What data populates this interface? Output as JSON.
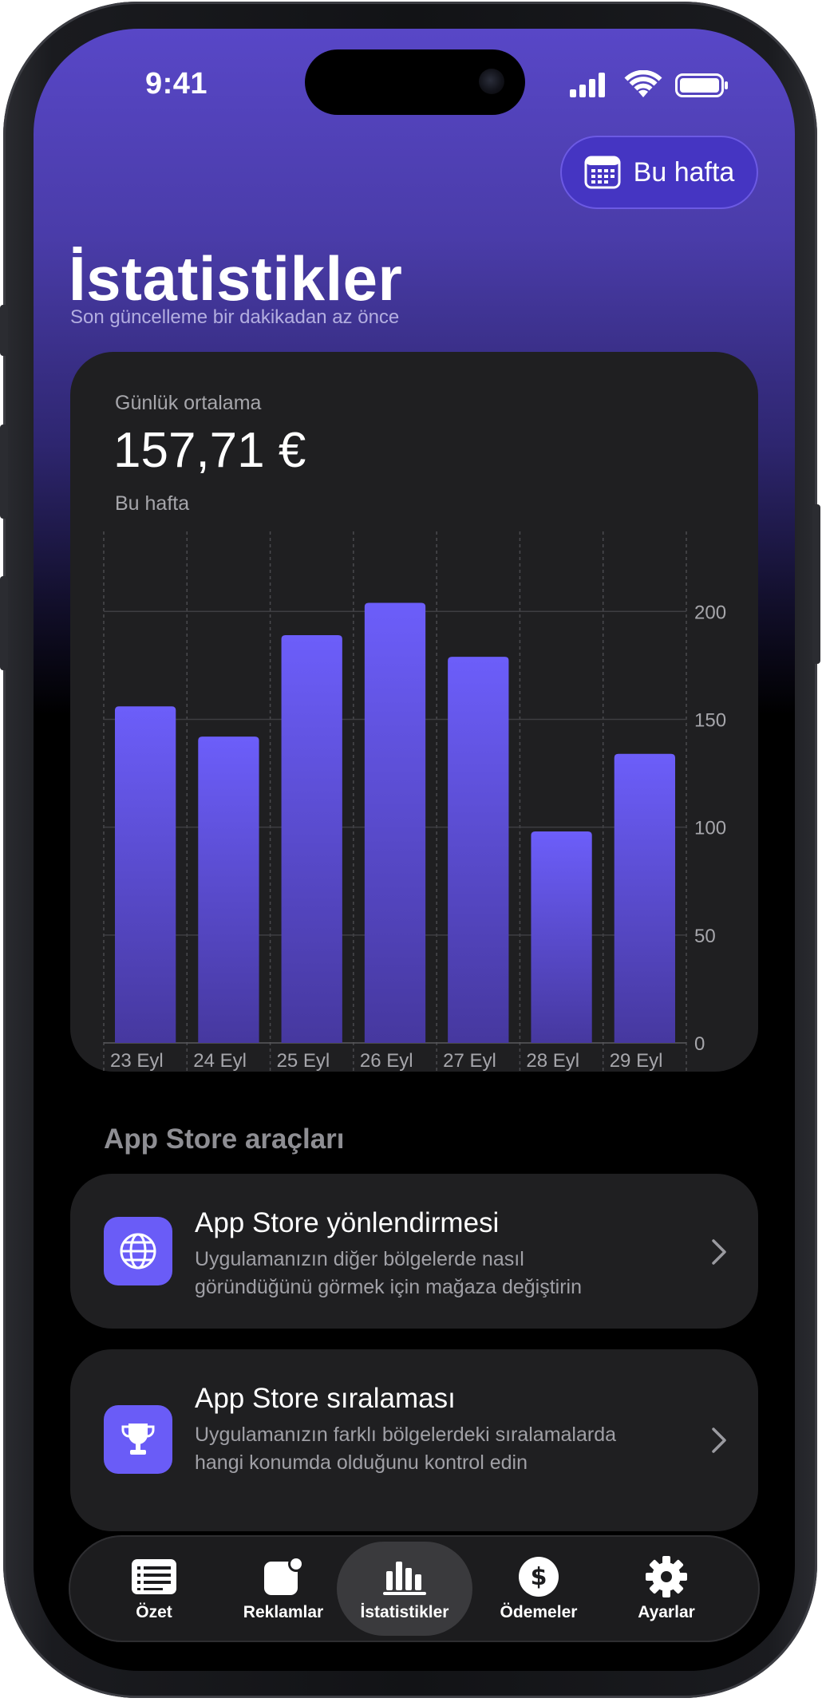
{
  "status": {
    "time": "9:41"
  },
  "header": {
    "period_button": "Bu hafta",
    "title": "İstatistikler",
    "subtitle": "Son güncelleme bir dakikadan az önce"
  },
  "stats": {
    "label": "Günlük ortalama",
    "value": "157,71 €",
    "period": "Bu hafta"
  },
  "chart_data": {
    "type": "bar",
    "categories": [
      "23 Eyl",
      "24 Eyl",
      "25 Eyl",
      "26 Eyl",
      "27 Eyl",
      "28 Eyl",
      "29 Eyl"
    ],
    "values": [
      156,
      142,
      189,
      204,
      179,
      98,
      134
    ],
    "ylim": [
      0,
      200
    ],
    "yticks": [
      0,
      50,
      100,
      150,
      200
    ],
    "y_axis_side": "right",
    "grid": true,
    "bar_color": "#6a5cf7"
  },
  "tools": {
    "section_title": "App Store araçları",
    "items": [
      {
        "title": "App Store yönlendirmesi",
        "desc": "Uygulamanızın diğer bölgelerde nasıl göründüğünü görmek için mağaza değiştirin",
        "icon": "globe-icon"
      },
      {
        "title": "App Store sıralaması",
        "desc": "Uygulamanızın farklı bölgelerdeki sıralamalarda hangi konumda olduğunu kontrol edin",
        "icon": "trophy-icon"
      }
    ]
  },
  "tabs": [
    {
      "label": "Özet",
      "icon": "list-icon"
    },
    {
      "label": "Reklamlar",
      "icon": "ads-badge-icon"
    },
    {
      "label": "İstatistikler",
      "icon": "bar-chart-icon",
      "active": true
    },
    {
      "label": "Ödemeler",
      "icon": "dollar-icon"
    },
    {
      "label": "Ayarlar",
      "icon": "gear-icon"
    }
  ],
  "colors": {
    "accent": "#6a5cf7",
    "header_top": "#5847c7",
    "card": "#1f1f21",
    "background": "#000000"
  }
}
